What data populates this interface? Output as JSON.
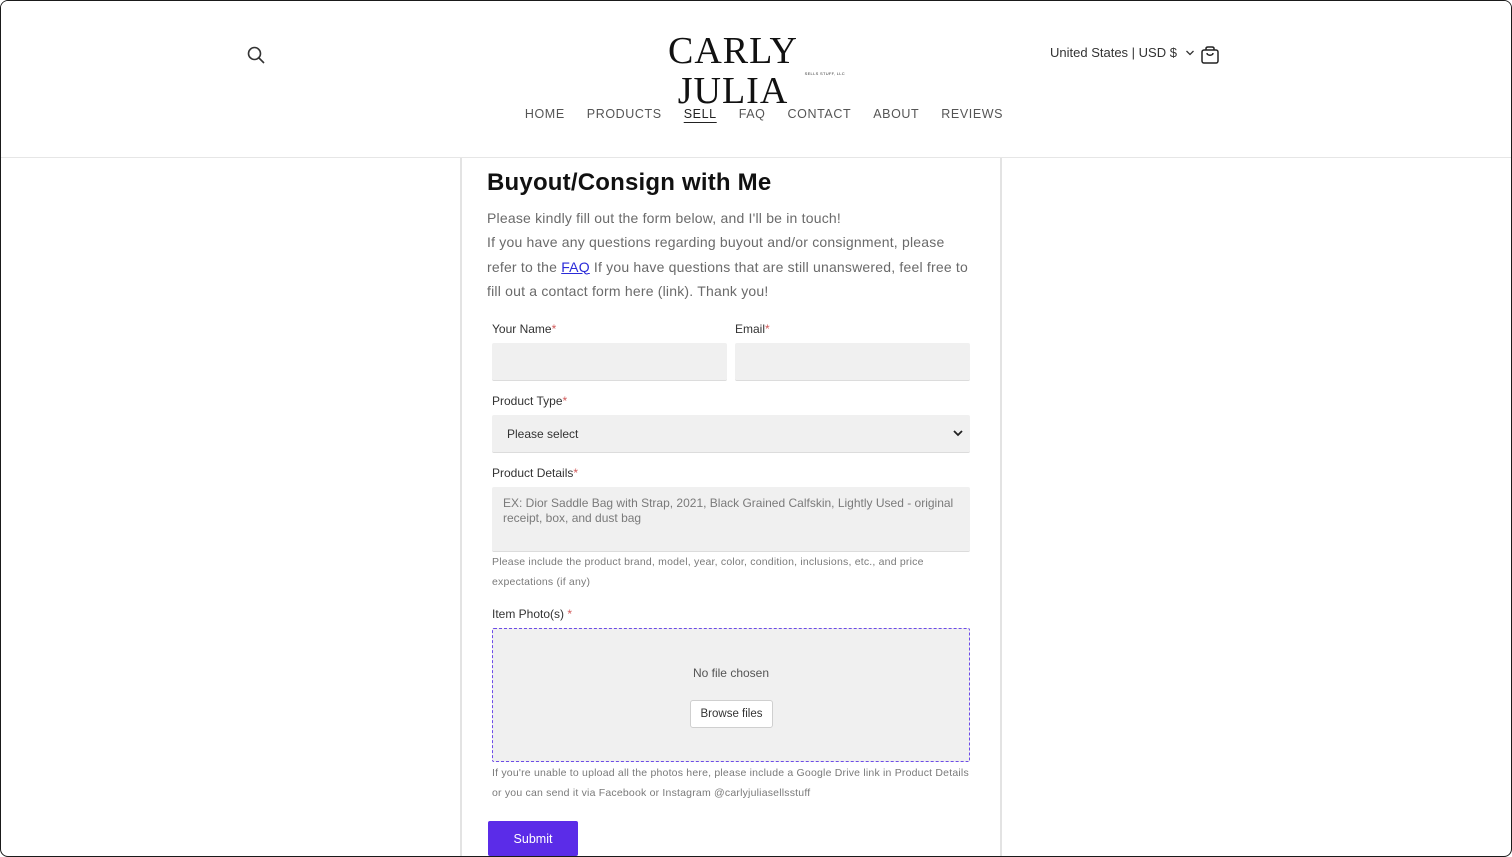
{
  "header": {
    "logo_main": "CARLY JULIA",
    "logo_sub": "SELLS STUFF, LLC",
    "currency": "United States | USD $",
    "icons": {
      "search": "search-icon",
      "currency_chevron": "chevron-down-icon",
      "cart": "cart-icon"
    }
  },
  "nav": {
    "items": [
      {
        "label": "HOME"
      },
      {
        "label": "PRODUCTS"
      },
      {
        "label": "SELL",
        "active": true
      },
      {
        "label": "FAQ"
      },
      {
        "label": "CONTACT"
      },
      {
        "label": "ABOUT"
      },
      {
        "label": "REVIEWS"
      }
    ]
  },
  "main": {
    "title": "Buyout/Consign with Me",
    "intro_line1": "Please kindly fill out the form below, and I'll be in touch!",
    "intro_line2_a": "If you have any questions regarding buyout and/or consignment, please refer to the ",
    "intro_faq_link": "FAQ",
    "intro_line2_b": " If you have questions that are still unanswered, feel free to fill out a contact form here (link). Thank you!"
  },
  "form": {
    "required_mark": "*",
    "name_label": "Your Name",
    "email_label": "Email",
    "product_type_label": "Product Type",
    "product_type_selected": "Please select",
    "product_details_label": "Product Details",
    "product_details_placeholder": "EX: Dior Saddle Bag with Strap, 2021, Black Grained Calfskin, Lightly Used - original receipt, box, and dust bag",
    "product_details_help": "Please include the product brand, model, year, color, condition, inclusions, etc., and price expectations (if any)",
    "photos_label": "Item Photo(s)",
    "no_file_text": "No file chosen",
    "browse_label": "Browse files",
    "photos_help": "If you're unable to upload all the photos here, please include a Google Drive link in Product Details or you can send it via Facebook or Instagram @carlyjuliasellsstuff",
    "submit_label": "Submit"
  },
  "colors": {
    "accent": "#5b2ce8",
    "dropzone_border": "#6d4ce8",
    "field_bg": "#f0f0f0",
    "link": "#2a2ad8"
  }
}
